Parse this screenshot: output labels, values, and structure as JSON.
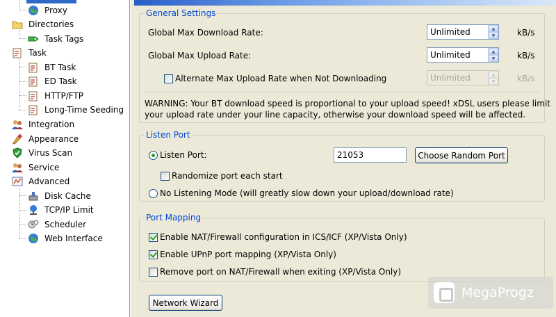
{
  "sidebar": {
    "items": [
      {
        "label": "Proxy",
        "icon": "globe-icon",
        "level": 1
      },
      {
        "label": "Directories",
        "icon": "folder-icon",
        "level": 0
      },
      {
        "label": "Task Tags",
        "icon": "tag-icon",
        "level": 1
      },
      {
        "label": "Task",
        "icon": "task-icon",
        "level": 0
      },
      {
        "label": "BT Task",
        "icon": "task-icon",
        "level": 1
      },
      {
        "label": "ED Task",
        "icon": "task-icon",
        "level": 1
      },
      {
        "label": "HTTP/FTP",
        "icon": "task-icon",
        "level": 1
      },
      {
        "label": "Long-Time Seeding",
        "icon": "task-icon",
        "level": 1
      },
      {
        "label": "Integration",
        "icon": "users-icon",
        "level": 0
      },
      {
        "label": "Appearance",
        "icon": "paint-icon",
        "level": 0
      },
      {
        "label": "Virus Scan",
        "icon": "shield-icon",
        "level": 0
      },
      {
        "label": "Service",
        "icon": "users-icon",
        "level": 0
      },
      {
        "label": "Advanced",
        "icon": "advanced-icon",
        "level": 0
      },
      {
        "label": "Disk Cache",
        "icon": "disk-icon",
        "level": 1
      },
      {
        "label": "TCP/IP Limit",
        "icon": "network-icon",
        "level": 1
      },
      {
        "label": "Scheduler",
        "icon": "scheduler-icon",
        "level": 1
      },
      {
        "label": "Web Interface",
        "icon": "globe-icon",
        "level": 1
      }
    ]
  },
  "general": {
    "title": "General Settings",
    "max_download_label": "Global Max Download Rate:",
    "max_download_value": "Unlimited",
    "max_upload_label": "Global Max Upload Rate:",
    "max_upload_value": "Unlimited",
    "unit": "kB/s",
    "alt_upload_label": "Alternate Max Upload Rate when Not Downloading",
    "alt_upload_value": "Unlimited",
    "alt_upload_checked": false,
    "warning_line1": "WARNING: Your BT download speed is proportional to your upload speed! xDSL users please limit",
    "warning_line2": "your upload rate under your line capacity, otherwise your download speed will be affected."
  },
  "listen": {
    "title": "Listen Port",
    "listen_port_label": "Listen Port:",
    "port_value": "21053",
    "random_button": "Choose Random Port",
    "randomize_label": "Randomize port each start",
    "no_listen_label": "No Listening Mode (will greatly slow down your upload/download rate)"
  },
  "mapping": {
    "title": "Port Mapping",
    "nat_label": "Enable NAT/Firewall configuration in ICS/ICF (XP/Vista Only)",
    "upnp_label": "Enable UPnP port mapping (XP/Vista Only)",
    "remove_label": "Remove port on NAT/Firewall when exiting (XP/Vista Only)"
  },
  "network_wizard_button": "Network Wizard",
  "watermark": "MegaProgz"
}
